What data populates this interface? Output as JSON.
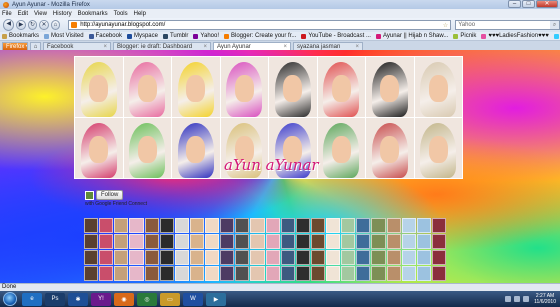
{
  "window": {
    "title": "Ayun Ayunar - Mozilla Firefox",
    "min": "–",
    "max": "□",
    "close": "✕"
  },
  "menu": [
    "File",
    "Edit",
    "View",
    "History",
    "Bookmarks",
    "Tools",
    "Help"
  ],
  "nav": {
    "url": "http://ayunayunar.blogspot.com/",
    "search_placeholder": "Yahoo"
  },
  "bookmarks": [
    {
      "label": "Bookmarks",
      "color": "#c7a04a"
    },
    {
      "label": "Most Visited",
      "color": "#7aa6d8"
    },
    {
      "label": "Facebook",
      "color": "#3b5998"
    },
    {
      "label": "Myspace",
      "color": "#1d4c9c"
    },
    {
      "label": "Tumblr",
      "color": "#2c4762"
    },
    {
      "label": "Yahoo!",
      "color": "#7b0099"
    },
    {
      "label": "Blogger: Create your fr...",
      "color": "#f57d00"
    },
    {
      "label": "YouTube - Broadcast ...",
      "color": "#cc181e"
    },
    {
      "label": "Ayunar || Hijab n Shaw...",
      "color": "#d41979"
    },
    {
      "label": "Picnik",
      "color": "#9bbf3a"
    },
    {
      "label": "♥♥♥LadiesFashion♥♥♥",
      "color": "#e54fa1"
    },
    {
      "label": "Twitter",
      "color": "#33ccff"
    },
    {
      "label": "Ping Your Blog!",
      "color": "#4a7bd0"
    }
  ],
  "tabs": [
    {
      "label": "Firefox ▾",
      "kind": "ffmenu"
    },
    {
      "label": "⌂",
      "kind": "home"
    },
    {
      "label": "Facebook",
      "kind": "normal"
    },
    {
      "label": "Blogger: ie draft: Dashboard",
      "kind": "normal"
    },
    {
      "label": "Ayun Ayunar",
      "kind": "active"
    },
    {
      "label": "syazana jasman",
      "kind": "normal"
    }
  ],
  "blog": {
    "title": "aYun aYunar",
    "follow_label": "Follow",
    "followers_text": "with Google Friend Connect",
    "photo_hijab_colors": [
      "#e7d548",
      "#e86a9f",
      "#f3d22a",
      "#d94fbf",
      "#2a2a2a",
      "#e04f4f",
      "#1a1a1a",
      "#d8c9b0",
      "#d43a6b",
      "#6bbf59",
      "#2d2fbf",
      "#d9c07a",
      "#3a3acb",
      "#5ba65a",
      "#c74a4a",
      "#c2b589"
    ],
    "follower_colors": [
      "#5a4030",
      "#d9b38c",
      "#2e2e2e",
      "#b6d3e8",
      "#8a5a3c",
      "#e3c6b0",
      "#3f6d9a",
      "#c94e6b",
      "#f1d9c4",
      "#6b4a2f",
      "#9cc2e0",
      "#2b2b2b",
      "#e2a7b8",
      "#7d8f56",
      "#c4a07a",
      "#4d3b63",
      "#f0e4d6",
      "#8b2f3c",
      "#d8d8d8",
      "#3d5a80",
      "#b98f6a",
      "#e6b7c9",
      "#515151",
      "#a3c8a0"
    ]
  },
  "status": {
    "text": "Done"
  },
  "taskbar": {
    "apps": [
      {
        "label": "e",
        "color": "#1f6fc2"
      },
      {
        "label": "Ps",
        "color": "#1b3d6b"
      },
      {
        "label": "✱",
        "color": "#1e4f96"
      },
      {
        "label": "Y!",
        "color": "#6a1a8c"
      },
      {
        "label": "◉",
        "color": "#d86a1a"
      },
      {
        "label": "◎",
        "color": "#2a7a3a"
      },
      {
        "label": "▭",
        "color": "#c99a2a"
      },
      {
        "label": "W",
        "color": "#1f4fa0"
      },
      {
        "label": "▶",
        "color": "#2c6e9c"
      }
    ],
    "time": "2:27 AM",
    "date": "11/6/2010"
  }
}
